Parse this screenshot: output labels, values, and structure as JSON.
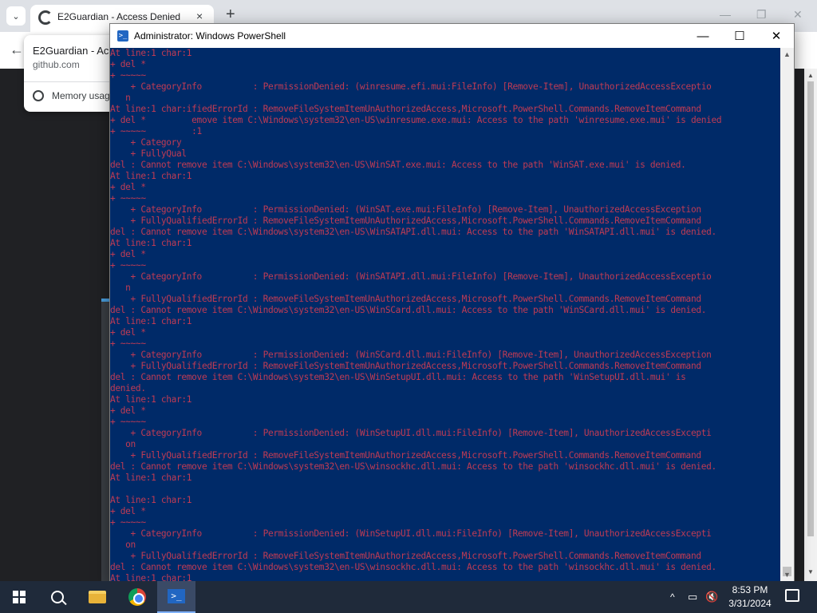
{
  "browser": {
    "tab_title": "E2Guardian - Access Denied",
    "tab_close": "×",
    "new_tab": "+",
    "tab_search": "⌄",
    "minimize": "—",
    "restore": "❐",
    "close": "✕",
    "back": "←",
    "hovercard": {
      "title": "E2Guardian - Ac",
      "url": "github.com",
      "memory": "Memory usag"
    }
  },
  "powershell": {
    "title": "Administrator: Windows PowerShell",
    "icon_glyph": ">_",
    "minimize": "—",
    "maximize": "☐",
    "close": "✕",
    "lines": [
      "At line:1 char:1",
      "+ del *",
      "+ ~~~~~",
      "    + CategoryInfo          : PermissionDenied: (winresume.efi.mui:FileInfo) [Remove-Item], UnauthorizedAccessExceptio",
      "   n",
      "At line:1 char:ifiedErrorId : RemoveFileSystemItemUnAuthorizedAccess,Microsoft.PowerShell.Commands.RemoveItemCommand",
      "+ del *         emove item C:\\Windows\\system32\\en-US\\winresume.exe.mui: Access to the path 'winresume.exe.mui' is denied",
      "+ ~~~~~         :1",
      "    + Category",
      "    + FullyQual",
      "del : Cannot remove item C:\\Windows\\system32\\en-US\\WinSAT.exe.mui: Access to the path 'WinSAT.exe.mui' is denied.",
      "At line:1 char:1",
      "+ del *",
      "+ ~~~~~",
      "    + CategoryInfo          : PermissionDenied: (WinSAT.exe.mui:FileInfo) [Remove-Item], UnauthorizedAccessException",
      "    + FullyQualifiedErrorId : RemoveFileSystemItemUnAuthorizedAccess,Microsoft.PowerShell.Commands.RemoveItemCommand",
      "del : Cannot remove item C:\\Windows\\system32\\en-US\\WinSATAPI.dll.mui: Access to the path 'WinSATAPI.dll.mui' is denied.",
      "At line:1 char:1",
      "+ del *",
      "+ ~~~~~",
      "    + CategoryInfo          : PermissionDenied: (WinSATAPI.dll.mui:FileInfo) [Remove-Item], UnauthorizedAccessExceptio",
      "   n",
      "    + FullyQualifiedErrorId : RemoveFileSystemItemUnAuthorizedAccess,Microsoft.PowerShell.Commands.RemoveItemCommand",
      "del : Cannot remove item C:\\Windows\\system32\\en-US\\WinSCard.dll.mui: Access to the path 'WinSCard.dll.mui' is denied.",
      "At line:1 char:1",
      "+ del *",
      "+ ~~~~~",
      "    + CategoryInfo          : PermissionDenied: (WinSCard.dll.mui:FileInfo) [Remove-Item], UnauthorizedAccessException",
      "    + FullyQualifiedErrorId : RemoveFileSystemItemUnAuthorizedAccess,Microsoft.PowerShell.Commands.RemoveItemCommand",
      "del : Cannot remove item C:\\Windows\\system32\\en-US\\WinSetupUI.dll.mui: Access to the path 'WinSetupUI.dll.mui' is",
      "denied.",
      "At line:1 char:1",
      "+ del *",
      "+ ~~~~~",
      "    + CategoryInfo          : PermissionDenied: (WinSetupUI.dll.mui:FileInfo) [Remove-Item], UnauthorizedAccessExcepti",
      "   on",
      "    + FullyQualifiedErrorId : RemoveFileSystemItemUnAuthorizedAccess,Microsoft.PowerShell.Commands.RemoveItemCommand",
      "del : Cannot remove item C:\\Windows\\system32\\en-US\\winsockhc.dll.mui: Access to the path 'winsockhc.dll.mui' is denied.",
      "At line:1 char:1",
      "",
      "At line:1 char:1",
      "+ del *",
      "+ ~~~~~",
      "    + CategoryInfo          : PermissionDenied: (WinSetupUI.dll.mui:FileInfo) [Remove-Item], UnauthorizedAccessExcepti",
      "   on",
      "    + FullyQualifiedErrorId : RemoveFileSystemItemUnAuthorizedAccess,Microsoft.PowerShell.Commands.RemoveItemCommand",
      "del : Cannot remove item C:\\Windows\\system32\\en-US\\winsockhc.dll.mui: Access to the path 'winsockhc.dll.mui' is denied.",
      "At line:1 char:1"
    ]
  },
  "taskbar": {
    "time": "8:53 PM",
    "date": "3/31/2024",
    "tray_chevron": "^",
    "icons": [
      "windows-start-icon",
      "search-icon",
      "file-explorer-icon",
      "chrome-icon",
      "powershell-icon"
    ]
  },
  "colors": {
    "console_bg": "#012456",
    "error_text": "#ff3b3b"
  }
}
